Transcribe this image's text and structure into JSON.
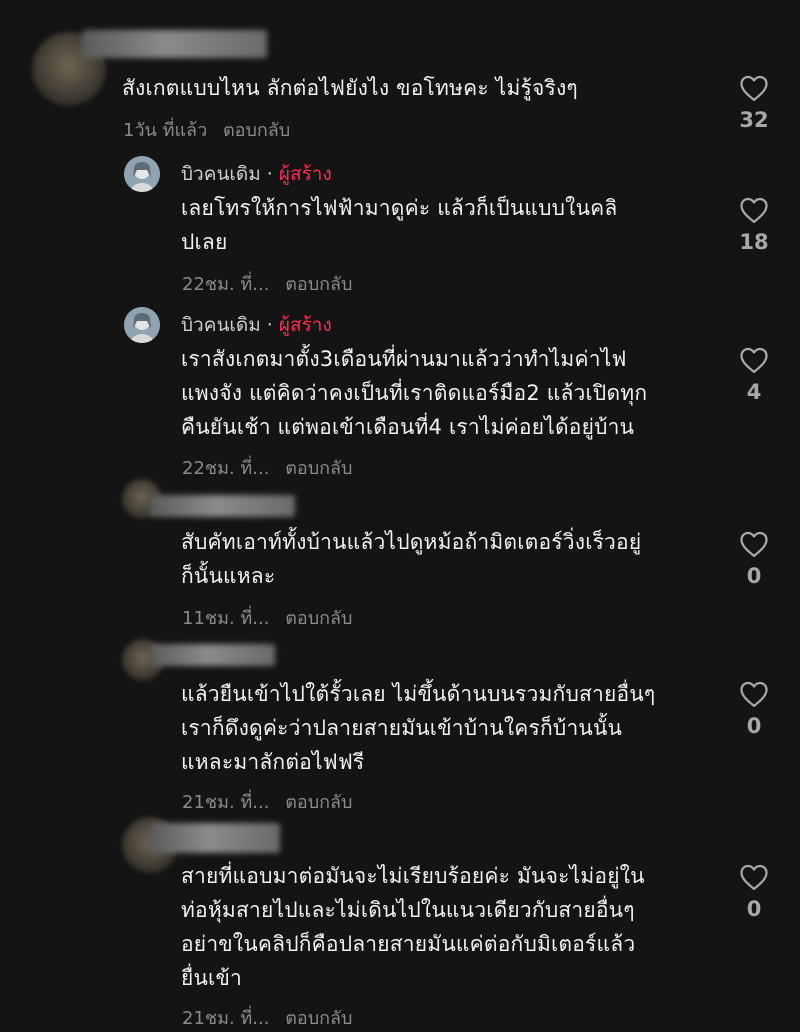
{
  "comments": [
    {
      "name": "",
      "text": "สังเกตแบบไหน ลักต่อไฟยังไง ขอโทษคะ ไม่รู้จริงๆ",
      "time": "1วัน ที่แล้ว",
      "reply": "ตอบกลับ",
      "likes": "32"
    },
    {
      "name": "บิวคนเดิม",
      "creator_label": "ผู้สร้าง",
      "separator": "·",
      "text_lines": [
        "เลยโทรให้การไฟฟ้ามาดูค่ะ แล้วก็เป็นแบบในคลิ",
        "ปเลย"
      ],
      "time": "22ชม. ที่...",
      "reply": "ตอบกลับ",
      "likes": "18"
    },
    {
      "name": "บิวคนเดิม",
      "creator_label": "ผู้สร้าง",
      "separator": "·",
      "text_lines": [
        "เราสังเกตมาตั้ง3เดือนที่ผ่านมาแล้วว่าทำไมค่าไฟ",
        "แพงจัง แต่คิดว่าคงเป็นที่เราติดแอร์มือ2 แล้วเปิดทุก",
        "คืนยันเช้า แต่พอเข้าเดือนที่4 เราไม่ค่อยได้อยู่บ้าน"
      ],
      "time": "22ชม. ที่...",
      "reply": "ตอบกลับ",
      "likes": "4"
    },
    {
      "name": "",
      "text_lines": [
        "สับคัทเอาท์ทั้งบ้านแล้วไปดูหม้อถ้ามิตเตอร์วิ่งเร็วอยู่",
        "ก็นั้นแหละ"
      ],
      "time": "11ชม. ที่...",
      "reply": "ตอบกลับ",
      "likes": "0"
    },
    {
      "name": "",
      "text_lines": [
        "แล้วยืนเข้าไปใต้รั้วเลย ไม่ขึ้นด้านบนรวมกับสายอื่นๆ",
        "เราก็ดึงดูค่ะว่าปลายสายมันเข้าบ้านใครก็บ้านนั้น",
        "แหละมาลักต่อไฟฟรี"
      ],
      "time": "21ชม. ที่...",
      "reply": "ตอบกลับ",
      "likes": "0"
    },
    {
      "name": "",
      "text_lines": [
        "สายที่แอบมาต่อมันจะไม่เรียบร้อยค่ะ มันจะไม่อยู่ใน",
        "ท่อหุ้มสายไปและไม่เดินไปในแนวเดียวกับสายอื่นๆ",
        "อย่าขในคลิปก็คือปลายสายมันแค่ต่อกับมิเตอร์แล้ว",
        "ยื่นเข้า"
      ],
      "time": "21ชม. ที่...",
      "reply": "ตอบกลับ",
      "likes": "0"
    }
  ],
  "icons": {
    "like": "heart-outline-icon"
  },
  "colors": {
    "background": "#141414",
    "creator": "#fe2c55",
    "meta": "#8a8a8a"
  }
}
